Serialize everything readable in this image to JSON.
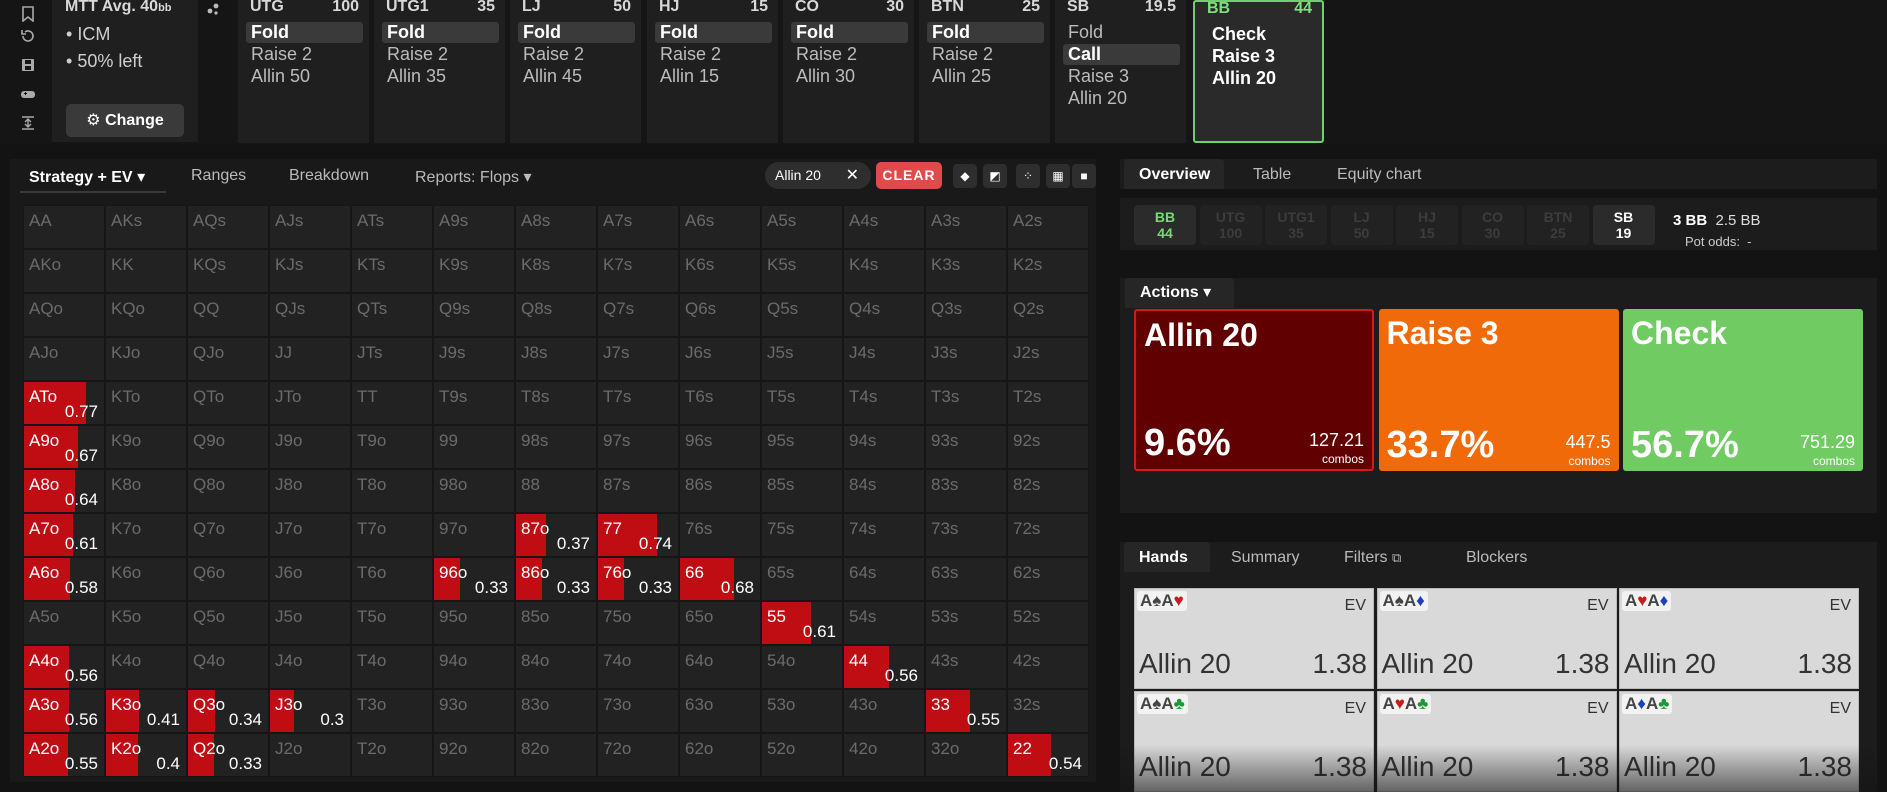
{
  "header": {
    "format": "MTT",
    "avg_label": "Avg. 40",
    "avg_unit": "bb",
    "bullets": [
      "ICM",
      "50% left"
    ],
    "change_label": "Change",
    "players": [
      {
        "pos": "UTG",
        "stack": "100",
        "actions": [
          {
            "label": "Fold",
            "selected": true
          },
          {
            "label": "Raise 2",
            "selected": false
          },
          {
            "label": "Allin 50",
            "selected": false
          }
        ]
      },
      {
        "pos": "UTG1",
        "stack": "35",
        "actions": [
          {
            "label": "Fold",
            "selected": true
          },
          {
            "label": "Raise 2",
            "selected": false
          },
          {
            "label": "Allin 35",
            "selected": false
          }
        ]
      },
      {
        "pos": "LJ",
        "stack": "50",
        "actions": [
          {
            "label": "Fold",
            "selected": true
          },
          {
            "label": "Raise 2",
            "selected": false
          },
          {
            "label": "Allin 45",
            "selected": false
          }
        ]
      },
      {
        "pos": "HJ",
        "stack": "15",
        "actions": [
          {
            "label": "Fold",
            "selected": true
          },
          {
            "label": "Raise 2",
            "selected": false
          },
          {
            "label": "Allin 15",
            "selected": false
          }
        ]
      },
      {
        "pos": "CO",
        "stack": "30",
        "actions": [
          {
            "label": "Fold",
            "selected": true
          },
          {
            "label": "Raise 2",
            "selected": false
          },
          {
            "label": "Allin 30",
            "selected": false
          }
        ]
      },
      {
        "pos": "BTN",
        "stack": "25",
        "actions": [
          {
            "label": "Fold",
            "selected": true
          },
          {
            "label": "Raise 2",
            "selected": false
          },
          {
            "label": "Allin 25",
            "selected": false
          }
        ]
      },
      {
        "pos": "SB",
        "stack": "19.5",
        "actions": [
          {
            "label": "Fold",
            "selected": false
          },
          {
            "label": "Call",
            "selected": true
          },
          {
            "label": "Raise 3",
            "selected": false
          },
          {
            "label": "Allin 20",
            "selected": false
          }
        ]
      },
      {
        "pos": "BB",
        "stack": "44",
        "actions": [
          {
            "label": "Check",
            "selected": false
          },
          {
            "label": "Raise 3",
            "selected": false
          },
          {
            "label": "Allin 20",
            "selected": false
          }
        ]
      }
    ]
  },
  "left_tabs": [
    "Strategy + EV",
    "Ranges",
    "Breakdown",
    "Reports: Flops"
  ],
  "filter_chip": "Allin 20",
  "clear_label": "CLEAR",
  "grid": {
    "ranks": [
      "A",
      "K",
      "Q",
      "J",
      "T",
      "9",
      "8",
      "7",
      "6",
      "5",
      "4",
      "3",
      "2"
    ],
    "labels": [
      [
        "AA",
        "AKs",
        "AQs",
        "AJs",
        "ATs",
        "A9s",
        "A8s",
        "A7s",
        "A6s",
        "A5s",
        "A4s",
        "A3s",
        "A2s"
      ],
      [
        "AKo",
        "KK",
        "KQs",
        "KJs",
        "KTs",
        "K9s",
        "K8s",
        "K7s",
        "K6s",
        "K5s",
        "K4s",
        "K3s",
        "K2s"
      ],
      [
        "AQo",
        "KQo",
        "QQ",
        "QJs",
        "QTs",
        "Q9s",
        "Q8s",
        "Q7s",
        "Q6s",
        "Q5s",
        "Q4s",
        "Q3s",
        "Q2s"
      ],
      [
        "AJo",
        "KJo",
        "QJo",
        "JJ",
        "JTs",
        "J9s",
        "J8s",
        "J7s",
        "J6s",
        "J5s",
        "J4s",
        "J3s",
        "J2s"
      ],
      [
        "ATo",
        "KTo",
        "QTo",
        "JTo",
        "TT",
        "T9s",
        "T8s",
        "T7s",
        "T6s",
        "T5s",
        "T4s",
        "T3s",
        "T2s"
      ],
      [
        "A9o",
        "K9o",
        "Q9o",
        "J9o",
        "T9o",
        "99",
        "98s",
        "97s",
        "96s",
        "95s",
        "94s",
        "93s",
        "92s"
      ],
      [
        "A8o",
        "K8o",
        "Q8o",
        "J8o",
        "T8o",
        "98o",
        "88",
        "87s",
        "86s",
        "85s",
        "84s",
        "83s",
        "82s"
      ],
      [
        "A7o",
        "K7o",
        "Q7o",
        "J7o",
        "T7o",
        "97o",
        "87o",
        "77",
        "76s",
        "75s",
        "74s",
        "73s",
        "72s"
      ],
      [
        "A6o",
        "K6o",
        "Q6o",
        "J6o",
        "T6o",
        "96o",
        "86o",
        "76o",
        "66",
        "65s",
        "64s",
        "63s",
        "62s"
      ],
      [
        "A5o",
        "K5o",
        "Q5o",
        "J5o",
        "T5o",
        "95o",
        "85o",
        "75o",
        "65o",
        "55",
        "54s",
        "53s",
        "52s"
      ],
      [
        "A4o",
        "K4o",
        "Q4o",
        "J4o",
        "T4o",
        "94o",
        "84o",
        "74o",
        "64o",
        "54o",
        "44",
        "43s",
        "42s"
      ],
      [
        "A3o",
        "K3o",
        "Q3o",
        "J3o",
        "T3o",
        "93o",
        "83o",
        "73o",
        "63o",
        "53o",
        "43o",
        "33",
        "32s"
      ],
      [
        "A2o",
        "K2o",
        "Q2o",
        "J2o",
        "T2o",
        "92o",
        "82o",
        "72o",
        "62o",
        "52o",
        "42o",
        "32o",
        "22"
      ]
    ],
    "freqs": {
      "ATo": "0.77",
      "A9o": "0.67",
      "A8o": "0.64",
      "A7o": "0.61",
      "A6o": "0.58",
      "A4o": "0.56",
      "A3o": "0.56",
      "A2o": "0.55",
      "K3o": "0.41",
      "K2o": "0.4",
      "Q3o": "0.34",
      "Q2o": "0.33",
      "J3o": "0.3",
      "87o": "0.37",
      "77": "0.74",
      "96o": "0.33",
      "86o": "0.33",
      "76o": "0.33",
      "66": "0.68",
      "55": "0.61",
      "44": "0.56",
      "33": "0.55",
      "22": "0.54"
    },
    "display_labels": {
      "77": "77",
      "66": "66",
      "55": "55",
      "44": "44",
      "33": "33",
      "22": "22"
    }
  },
  "right_tabs": [
    "Overview",
    "Table",
    "Equity chart"
  ],
  "seats": [
    {
      "pos": "BB",
      "stack": "44",
      "state": "active"
    },
    {
      "pos": "UTG",
      "stack": "100",
      "state": "folded"
    },
    {
      "pos": "UTG1",
      "stack": "35",
      "state": "folded"
    },
    {
      "pos": "LJ",
      "stack": "50",
      "state": "folded"
    },
    {
      "pos": "HJ",
      "stack": "15",
      "state": "folded"
    },
    {
      "pos": "CO",
      "stack": "30",
      "state": "folded"
    },
    {
      "pos": "BTN",
      "stack": "25",
      "state": "folded"
    },
    {
      "pos": "SB",
      "stack": "19",
      "state": "in"
    }
  ],
  "pot": {
    "bb": "3 BB",
    "to_call": "2.5 BB",
    "odds_label": "Pot odds:",
    "odds_value": "-"
  },
  "actions_label": "Actions",
  "action_blocks": [
    {
      "name": "Allin 20",
      "pct": "9.6%",
      "combos": "127.21",
      "combos_label": "combos",
      "color": "#600000",
      "freq": 9.6
    },
    {
      "name": "Raise 3",
      "pct": "33.7%",
      "combos": "447.5",
      "combos_label": "combos",
      "color": "#f06a0a",
      "freq": 33.7
    },
    {
      "name": "Check",
      "pct": "56.7%",
      "combos": "751.29",
      "combos_label": "combos",
      "color": "#6fcb62",
      "freq": 56.7
    }
  ],
  "stack_bar_colors": [
    "#c8101a",
    "#f06a0a",
    "#6fcb62"
  ],
  "bottom_tabs": [
    "Hands",
    "Summary",
    "Filters",
    "Blockers"
  ],
  "hands": [
    {
      "cards": [
        {
          "rank": "A",
          "suit": "♠",
          "s": "s"
        },
        {
          "rank": "A",
          "suit": "♥",
          "s": "h"
        }
      ],
      "ev": "EV",
      "label": "Allin 20",
      "value": "1.38"
    },
    {
      "cards": [
        {
          "rank": "A",
          "suit": "♠",
          "s": "s"
        },
        {
          "rank": "A",
          "suit": "♦",
          "s": "d"
        }
      ],
      "ev": "EV",
      "label": "Allin 20",
      "value": "1.38"
    },
    {
      "cards": [
        {
          "rank": "A",
          "suit": "♥",
          "s": "h"
        },
        {
          "rank": "A",
          "suit": "♦",
          "s": "d"
        }
      ],
      "ev": "EV",
      "label": "Allin 20",
      "value": "1.38"
    },
    {
      "cards": [
        {
          "rank": "A",
          "suit": "♠",
          "s": "s"
        },
        {
          "rank": "A",
          "suit": "♣",
          "s": "c"
        }
      ],
      "ev": "EV",
      "label": "Allin 20",
      "value": "1.38"
    },
    {
      "cards": [
        {
          "rank": "A",
          "suit": "♥",
          "s": "h"
        },
        {
          "rank": "A",
          "suit": "♣",
          "s": "c"
        }
      ],
      "ev": "EV",
      "label": "Allin 20",
      "value": "1.38"
    },
    {
      "cards": [
        {
          "rank": "A",
          "suit": "♦",
          "s": "d"
        },
        {
          "rank": "A",
          "suit": "♣",
          "s": "c"
        }
      ],
      "ev": "EV",
      "label": "Allin 20",
      "value": "1.38"
    }
  ]
}
